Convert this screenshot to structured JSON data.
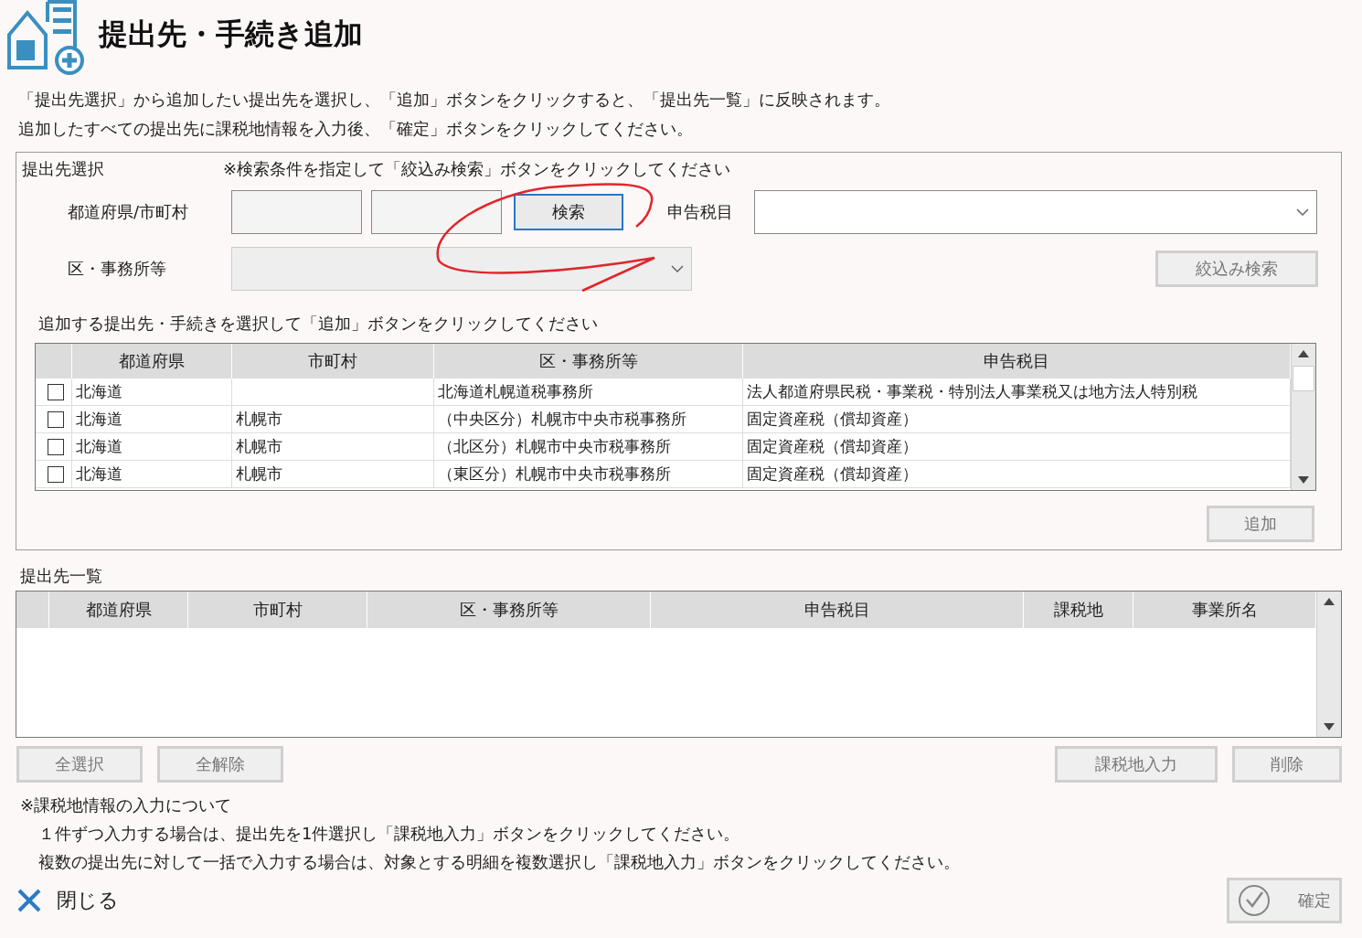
{
  "title": "提出先・手続き追加",
  "instructions": [
    "「提出先選択」から追加したい提出先を選択し、「追加」ボタンをクリックすると、「提出先一覧」に反映されます。",
    "追加したすべての提出先に課税地情報を入力後、「確定」ボタンをクリックしてください。"
  ],
  "selection_panel": {
    "label": "提出先選択",
    "hint": "※検索条件を指定して「絞込み検索」ボタンをクリックしてください",
    "prefecture_city_label": "都道府県/市町村",
    "search_button": {
      "label": "検索",
      "disabled": false
    },
    "tax_item_label": "申告税目",
    "tax_item_select": {
      "disabled": false
    },
    "office_label": "区・事務所等",
    "office_select": {
      "disabled": true
    },
    "filter_button": {
      "label": "絞込み検索",
      "disabled": true
    },
    "table_caption": "追加する提出先・手続きを選択して「追加」ボタンをクリックしてください",
    "table": {
      "columns": [
        "都道府県",
        "市町村",
        "区・事務所等",
        "申告税目"
      ],
      "rows": [
        {
          "checked": false,
          "cells": [
            "北海道",
            "",
            "北海道札幌道税事務所",
            "法人都道府県民税・事業税・特別法人事業税又は地方法人特別税"
          ]
        },
        {
          "checked": false,
          "cells": [
            "北海道",
            "札幌市",
            "（中央区分）札幌市中央市税事務所",
            "固定資産税（償却資産）"
          ]
        },
        {
          "checked": false,
          "cells": [
            "北海道",
            "札幌市",
            "（北区分）札幌市中央市税事務所",
            "固定資産税（償却資産）"
          ]
        },
        {
          "checked": false,
          "cells": [
            "北海道",
            "札幌市",
            "（東区分）札幌市中央市税事務所",
            "固定資産税（償却資産）"
          ]
        }
      ]
    },
    "add_button": {
      "label": "追加",
      "disabled": true
    }
  },
  "list_panel": {
    "label": "提出先一覧",
    "table": {
      "columns": [
        "都道府県",
        "市町村",
        "区・事務所等",
        "申告税目",
        "課税地",
        "事業所名"
      ]
    }
  },
  "left_buttons": [
    {
      "label": "全選択",
      "disabled": true
    },
    {
      "label": "全解除",
      "disabled": true
    }
  ],
  "right_buttons": [
    {
      "label": "課税地入力",
      "disabled": true
    },
    {
      "label": "削除",
      "disabled": true
    }
  ],
  "notes": {
    "heading": "※課税地情報の入力について",
    "lines": [
      "１件ずつ入力する場合は、提出先を1件選択し「課税地入力」ボタンをクリックしてください。",
      "複数の提出先に対して一括で入力する場合は、対象とする明細を複数選択し「課税地入力」ボタンをクリックしてください。"
    ]
  },
  "close_link": "閉じる",
  "confirm_button": {
    "label": "確定",
    "disabled": true
  }
}
